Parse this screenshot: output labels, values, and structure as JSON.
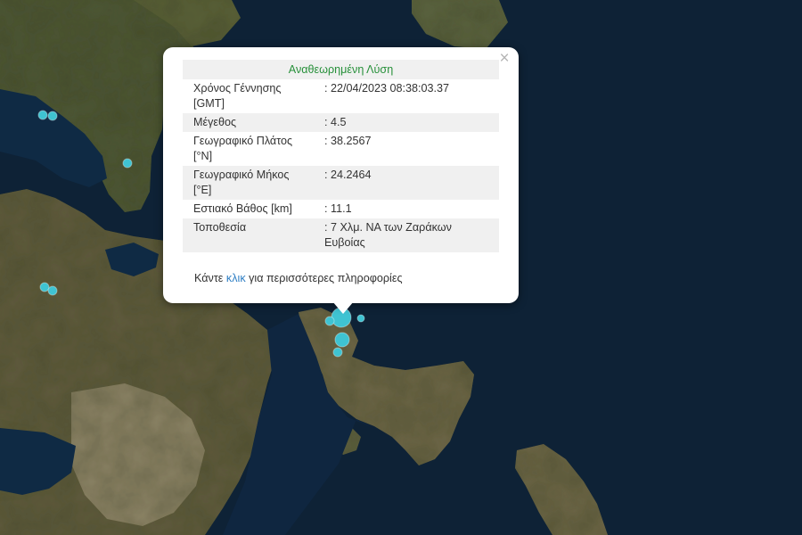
{
  "popup": {
    "title": "Αναθεωρημένη Λύση",
    "close_glyph": "×",
    "rows": [
      {
        "label": "Χρόνος Γέννησης\n[GMT]",
        "value": ": 22/04/2023 08:38:03.37"
      },
      {
        "label": "Μέγεθος",
        "value": ": 4.5"
      },
      {
        "label": "Γεωγραφικό Πλάτος\n[°N]",
        "value": ": 38.2567"
      },
      {
        "label": "Γεωγραφικό Μήκος\n[°E]",
        "value": ": 24.2464"
      },
      {
        "label": "Εστιακό Βάθος [km]",
        "value": ": 11.1"
      },
      {
        "label": "Τοποθεσία",
        "value": ": 7 Χλμ. ΝΑ των Ζαράκων\nΕυβοίας"
      }
    ],
    "more_prefix": "Κάντε ",
    "more_link": "κλικ",
    "more_suffix": " για περισσότερες πληροφορίες"
  },
  "colors": {
    "title_green": "#27903a",
    "link_blue": "#2f7fc4",
    "marker_cyan": "#3fc3d2",
    "sea": "#0e2236",
    "land": "#6b6444"
  },
  "markers": [
    {
      "lat": 38.2567,
      "lon": 24.2464,
      "magnitude": 4.5
    }
  ]
}
